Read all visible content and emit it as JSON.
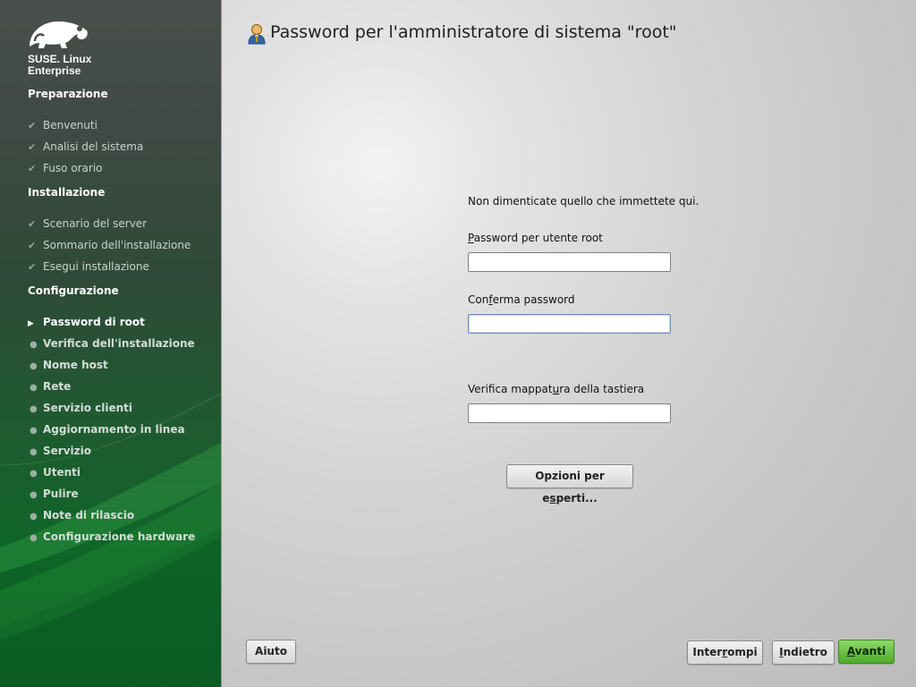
{
  "brand": {
    "line1": "SUSE. Linux",
    "line2": "Enterprise",
    "logo_icon": "chameleon-logo"
  },
  "sidebar": {
    "sections": [
      {
        "title": "Preparazione",
        "steps": [
          {
            "label": "Benvenuti",
            "state": "done"
          },
          {
            "label": "Analisi del sistema",
            "state": "done"
          },
          {
            "label": "Fuso orario",
            "state": "done"
          }
        ]
      },
      {
        "title": "Installazione",
        "steps": [
          {
            "label": "Scenario del server",
            "state": "done"
          },
          {
            "label": "Sommario dell'installazione",
            "state": "done"
          },
          {
            "label": "Esegui installazione",
            "state": "done"
          }
        ]
      },
      {
        "title": "Configurazione",
        "steps": [
          {
            "label": "Password di root",
            "state": "current"
          },
          {
            "label": "Verifica dell'installazione",
            "state": "pending"
          },
          {
            "label": "Nome host",
            "state": "pending"
          },
          {
            "label": "Rete",
            "state": "pending"
          },
          {
            "label": "Servizio clienti",
            "state": "pending"
          },
          {
            "label": "Aggiornamento in linea",
            "state": "pending"
          },
          {
            "label": "Servizio",
            "state": "pending"
          },
          {
            "label": "Utenti",
            "state": "pending"
          },
          {
            "label": "Pulire",
            "state": "pending"
          },
          {
            "label": "Note di rilascio",
            "state": "pending"
          },
          {
            "label": "Configurazione hardware",
            "state": "pending"
          }
        ]
      }
    ]
  },
  "markers": {
    "done": "✔",
    "current": "▶",
    "pending": "●"
  },
  "main": {
    "title": "Password per l'amministratore di sistema \"root\"",
    "title_icon": "user-key-icon",
    "info": "Non dimenticate quello che immettete qui.",
    "password_label": {
      "pre": "",
      "u": "P",
      "post": "assword per utente root"
    },
    "password_value": "",
    "confirm_label": {
      "pre": "Con",
      "u": "f",
      "post": "erma password"
    },
    "confirm_value": "",
    "keyboard_label": {
      "pre": "Verifica mappat",
      "u": "u",
      "post": "ra della tastiera"
    },
    "keyboard_value": "",
    "expert_button": {
      "pre": "Opzioni per e",
      "u": "s",
      "post": "perti..."
    }
  },
  "footer": {
    "help": "Aiuto",
    "abort": {
      "pre": "Inter",
      "u": "r",
      "post": "ompi"
    },
    "back": {
      "pre": "",
      "u": "I",
      "post": "ndietro"
    },
    "next": {
      "pre": "",
      "u": "A",
      "post": "vanti"
    }
  },
  "colors": {
    "accent_green": "#4fab2c",
    "sidebar_green": "#0f6628"
  }
}
